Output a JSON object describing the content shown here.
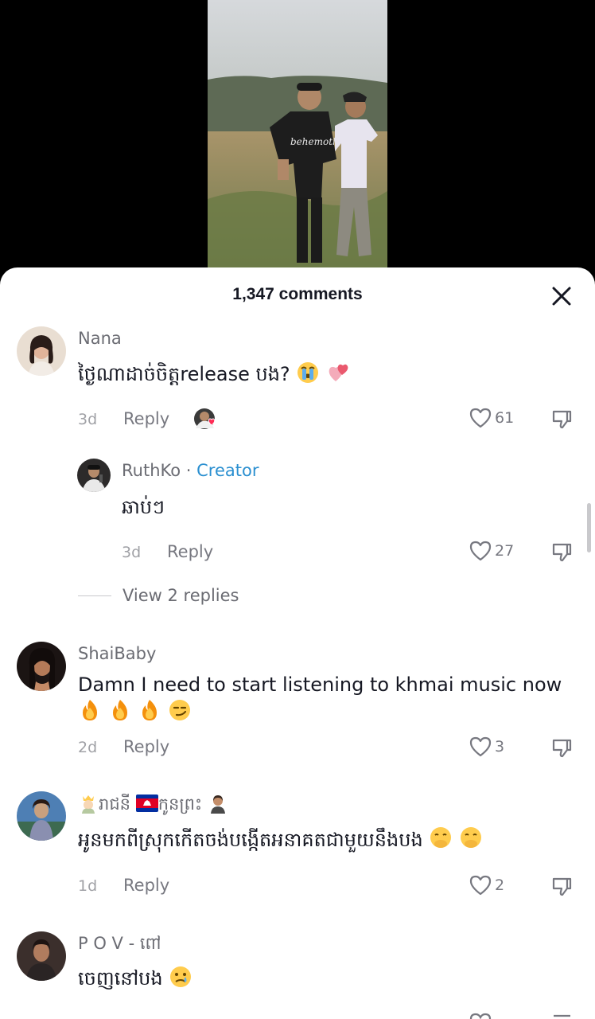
{
  "header": {
    "comments_count": "1,347 comments"
  },
  "comments": [
    {
      "username": "Nana",
      "text": "ថ្ងៃណាដាច់ចិត្តrelease បង?",
      "emojis": [
        "crying-face-emoji",
        "two-hearts-emoji"
      ],
      "time": "3d",
      "reply_label": "Reply",
      "likes": "61",
      "reply": {
        "username": "RuthKo",
        "creator_badge": "Creator",
        "separator": "·",
        "text": "ឆាប់ៗ",
        "time": "3d",
        "reply_label": "Reply",
        "likes": "27"
      },
      "view_replies": "View 2 replies"
    },
    {
      "username": "ShaiBaby",
      "text": "Damn I need to start listening to khmai music now",
      "emojis": [
        "fire-emoji",
        "fire-emoji",
        "fire-emoji",
        "smirk-emoji"
      ],
      "time": "2d",
      "reply_label": "Reply",
      "likes": "3"
    },
    {
      "username_parts": [
        "រាជនី",
        "កូនព្រះ"
      ],
      "username_emojis": [
        "princess-emoji",
        "cambodia-flag-emoji",
        "person-emoji"
      ],
      "text": "អូនមកពីស្រុកកើតចង់បង្កើតអនាគតជាមួយនឹងបង",
      "emojis": [
        "hand-over-mouth-emoji",
        "hand-over-mouth-emoji"
      ],
      "time": "1d",
      "reply_label": "Reply",
      "likes": "2"
    },
    {
      "username": "P O V - ពៅ",
      "text": "ចេញនៅបង",
      "emojis": [
        "crying-face-emoji"
      ]
    }
  ],
  "colors": {
    "creator": "#2a8fd0",
    "text": "#161823",
    "muted": "#777880",
    "heart": "#fe2c55"
  }
}
